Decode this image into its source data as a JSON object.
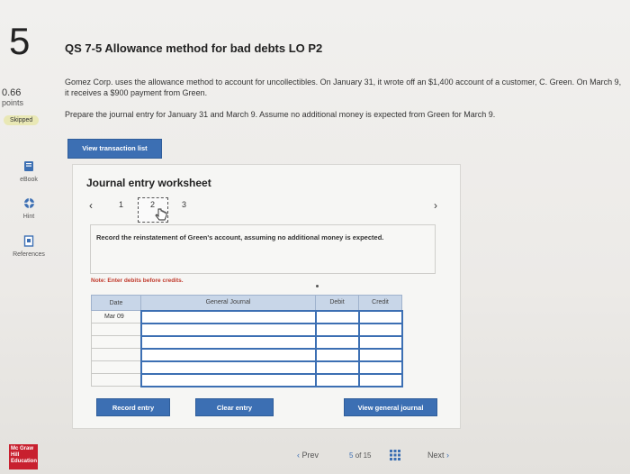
{
  "question": {
    "number": "5",
    "points_value": "0.66",
    "points_label": "points",
    "status": "Skipped",
    "title": "QS 7-5 Allowance method for bad debts LO P2",
    "description": "Gomez Corp. uses the allowance method to account for uncollectibles. On January 31, it wrote off an $1,400 account of a customer, C. Green. On March 9, it receives a $900 payment from Green.",
    "prompt": "Prepare the journal entry for January 31 and March 9. Assume no additional money is expected from Green for March 9."
  },
  "sidebar": {
    "ebook": "eBook",
    "hint": "Hint",
    "references": "References"
  },
  "buttons": {
    "view_transaction_list": "View transaction list",
    "record_entry": "Record entry",
    "clear_entry": "Clear entry",
    "view_general_journal": "View general journal"
  },
  "worksheet": {
    "title": "Journal entry worksheet",
    "pages": [
      "1",
      "2",
      "3"
    ],
    "current_page": "2",
    "instruction": "Record the reinstatement of Green's account, assuming no additional money is expected.",
    "note": "Note: Enter debits before credits.",
    "columns": [
      "Date",
      "General Journal",
      "Debit",
      "Credit"
    ],
    "rows": [
      {
        "date": "Mar 09",
        "account": "",
        "debit": "",
        "credit": ""
      },
      {
        "date": "",
        "account": "",
        "debit": "",
        "credit": ""
      },
      {
        "date": "",
        "account": "",
        "debit": "",
        "credit": ""
      },
      {
        "date": "",
        "account": "",
        "debit": "",
        "credit": ""
      },
      {
        "date": "",
        "account": "",
        "debit": "",
        "credit": ""
      },
      {
        "date": "",
        "account": "",
        "debit": "",
        "credit": ""
      }
    ]
  },
  "footer": {
    "logo_text": "Mc Graw Hill Education",
    "prev": "Prev",
    "page_current": "5",
    "page_of": "of",
    "page_total": "15",
    "next": "Next"
  },
  "colors": {
    "accent": "#3c6fb3",
    "skipped_badge": "#e9e8b5",
    "note_red": "#c0392b",
    "logo_red": "#c8202f"
  }
}
